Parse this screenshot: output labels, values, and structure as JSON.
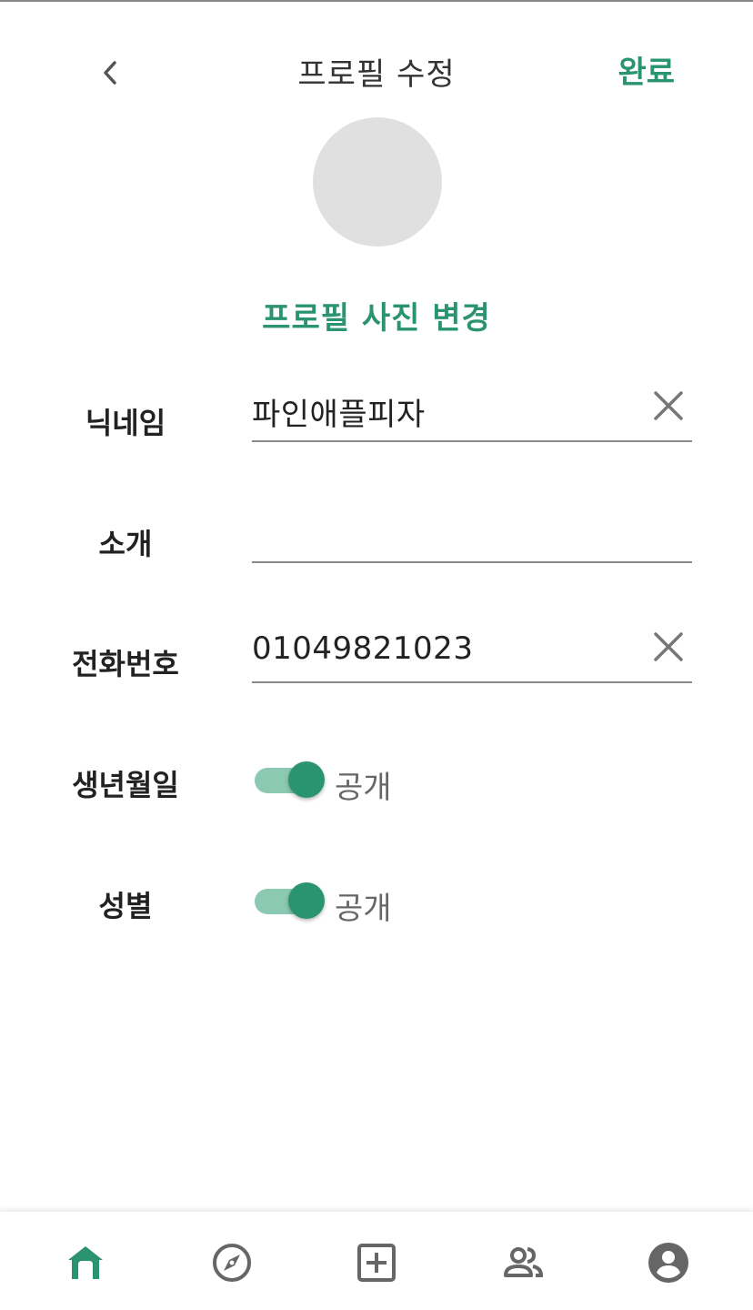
{
  "header": {
    "back_icon": "chevron-left-icon",
    "title": "프로필 수정",
    "done_label": "완료"
  },
  "profile": {
    "change_photo_label": "프로필 사진 변경"
  },
  "fields": {
    "nickname": {
      "label": "닉네임",
      "value": "파인애플피자"
    },
    "intro": {
      "label": "소개",
      "value": ""
    },
    "phone": {
      "label": "전화번호",
      "value": "01049821023"
    }
  },
  "toggles": {
    "birthday": {
      "label": "생년월일",
      "state_label": "공개",
      "on": true
    },
    "gender": {
      "label": "성별",
      "state_label": "공개",
      "on": true
    }
  },
  "bottom_nav": {
    "items": [
      {
        "icon": "home-icon",
        "active": true
      },
      {
        "icon": "compass-icon",
        "active": false
      },
      {
        "icon": "add-box-icon",
        "active": false
      },
      {
        "icon": "people-icon",
        "active": false
      },
      {
        "icon": "account-circle-icon",
        "active": false
      }
    ]
  },
  "colors": {
    "accent": "#2a9470",
    "track": "#8bc9b2",
    "icon_gray": "#666666"
  }
}
